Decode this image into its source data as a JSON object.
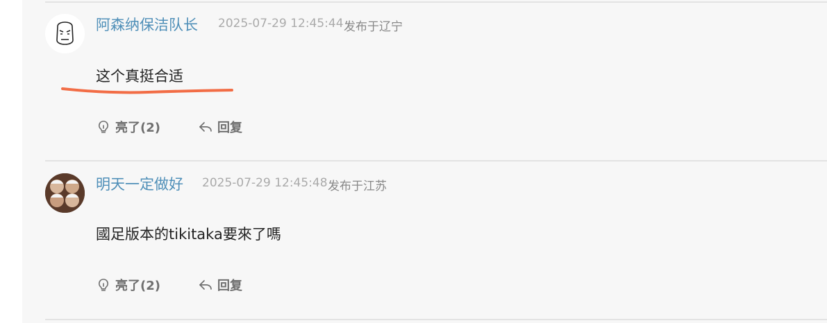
{
  "colors": {
    "background": "#f7f7f7",
    "username": "#4f8fb8",
    "meta": "#aaaaaa",
    "text": "#222222",
    "action": "#6f6f6f",
    "annotation": "#f26d46"
  },
  "comments": [
    {
      "username": "阿森纳保洁队长",
      "timestamp": "2025-07-29 12:45:44",
      "location": "发布于辽宁",
      "text": "这个真挺合适",
      "likes_label": "亮了(2)",
      "reply_label": "回复",
      "avatar": "face-sticker-avatar",
      "annotation": "orange-underline"
    },
    {
      "username": "明天一定做好",
      "timestamp": "2025-07-29 12:45:48",
      "location": "发布于江苏",
      "text": "國足版本的tikitaka要來了嗎",
      "likes_label": "亮了(2)",
      "reply_label": "回复",
      "avatar": "photo-avatar"
    }
  ],
  "icons": {
    "like": "lightbulb-icon",
    "reply": "reply-arrow-icon"
  }
}
